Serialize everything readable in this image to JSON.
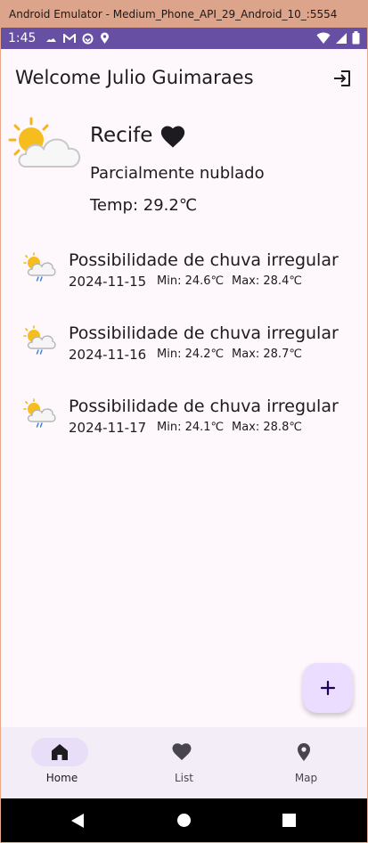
{
  "window": {
    "title": "Android Emulator - Medium_Phone_API_29_Android_10_:5554"
  },
  "status_bar": {
    "time": "1:45",
    "left_icons": [
      "cast-icon",
      "gmail-icon",
      "sync-icon",
      "location-icon"
    ],
    "right_icons": [
      "wifi-icon",
      "signal-icon",
      "battery-icon"
    ]
  },
  "app_bar": {
    "title": "Welcome Julio Guimaraes",
    "action_icon": "logout-icon"
  },
  "current": {
    "city": "Recife",
    "condition": "Parcialmente nublado",
    "temp": "Temp: 29.2℃",
    "icon": "partly-cloudy-icon",
    "favorite_icon": "heart-icon"
  },
  "forecast": [
    {
      "desc": "Possibilidade de chuva irregular",
      "date": "2024-11-15",
      "min": "Min: 24.6℃",
      "max": "Max: 28.4℃",
      "icon": "patchy-rain-icon"
    },
    {
      "desc": "Possibilidade de chuva irregular",
      "date": "2024-11-16",
      "min": "Min: 24.2℃",
      "max": "Max: 28.7℃",
      "icon": "patchy-rain-icon"
    },
    {
      "desc": "Possibilidade de chuva irregular",
      "date": "2024-11-17",
      "min": "Min: 24.1℃",
      "max": "Max: 28.8℃",
      "icon": "patchy-rain-icon"
    }
  ],
  "fab": {
    "icon": "plus-icon"
  },
  "nav": [
    {
      "label": "Home",
      "icon": "home-icon",
      "active": true
    },
    {
      "label": "List",
      "icon": "heart-icon",
      "active": false
    },
    {
      "label": "Map",
      "icon": "map-pin-icon",
      "active": false
    }
  ],
  "colors": {
    "primary": "#6750a4",
    "background": "#fef7fc",
    "fab": "#eaddff",
    "nav_bar": "#f3edf7",
    "nav_active_pill": "#e8def8"
  }
}
